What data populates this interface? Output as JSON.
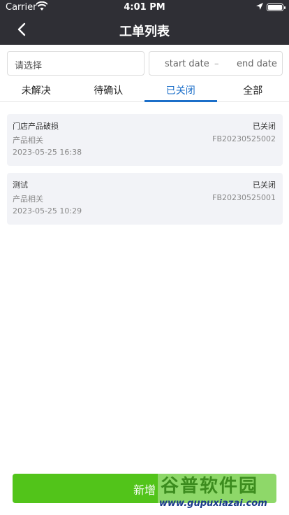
{
  "status_bar": {
    "carrier": "Carrier",
    "time": "4:01 PM"
  },
  "nav": {
    "title": "工单列表"
  },
  "filter": {
    "select_placeholder": "请选择",
    "start_date": "start date",
    "separator": "–",
    "end_date": "end date"
  },
  "tabs": [
    {
      "label": "未解决",
      "active": false
    },
    {
      "label": "待确认",
      "active": false
    },
    {
      "label": "已关闭",
      "active": true
    },
    {
      "label": "全部",
      "active": false
    }
  ],
  "tickets": [
    {
      "title": "门店产品破损",
      "status": "已关闭",
      "category": "产品相关",
      "number": "FB20230525002",
      "time": "2023-05-25 16:38"
    },
    {
      "title": "测试",
      "status": "已关闭",
      "category": "产品相关",
      "number": "FB20230525001",
      "time": "2023-05-25 10:29"
    }
  ],
  "add_button": {
    "label": "新增"
  },
  "watermark": {
    "title": "谷普软件园",
    "url": "www.gupuxiazai.com"
  },
  "colors": {
    "header_bg": "#2f2f35",
    "active_tab": "#1c6fc9",
    "add_button": "#52c41a",
    "card_bg": "#f2f3f7"
  }
}
